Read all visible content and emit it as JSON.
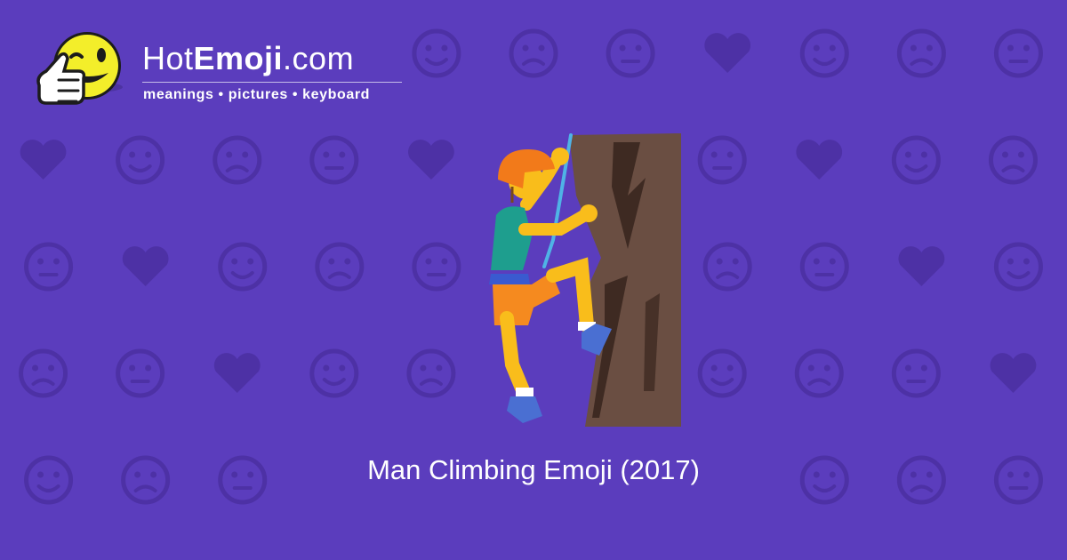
{
  "logo": {
    "name_part1": "Hot",
    "name_part2": "Emoji",
    "name_part3": ".com",
    "tagline": "meanings • pictures • keyboard"
  },
  "caption": {
    "text": "Man Climbing Emoji (2017)"
  },
  "colors": {
    "background": "#5b3dbd",
    "pattern_icon": "#4d31a5",
    "mascot_face": "#f3ee2a",
    "helmet": "#f27a1a",
    "skin": "#f9bd1b",
    "shirt": "#1e9e8e",
    "shorts": "#f58a1f",
    "shoes": "#4a6fd2",
    "rock": "#6a4e42",
    "rope": "#4fb3e6"
  }
}
